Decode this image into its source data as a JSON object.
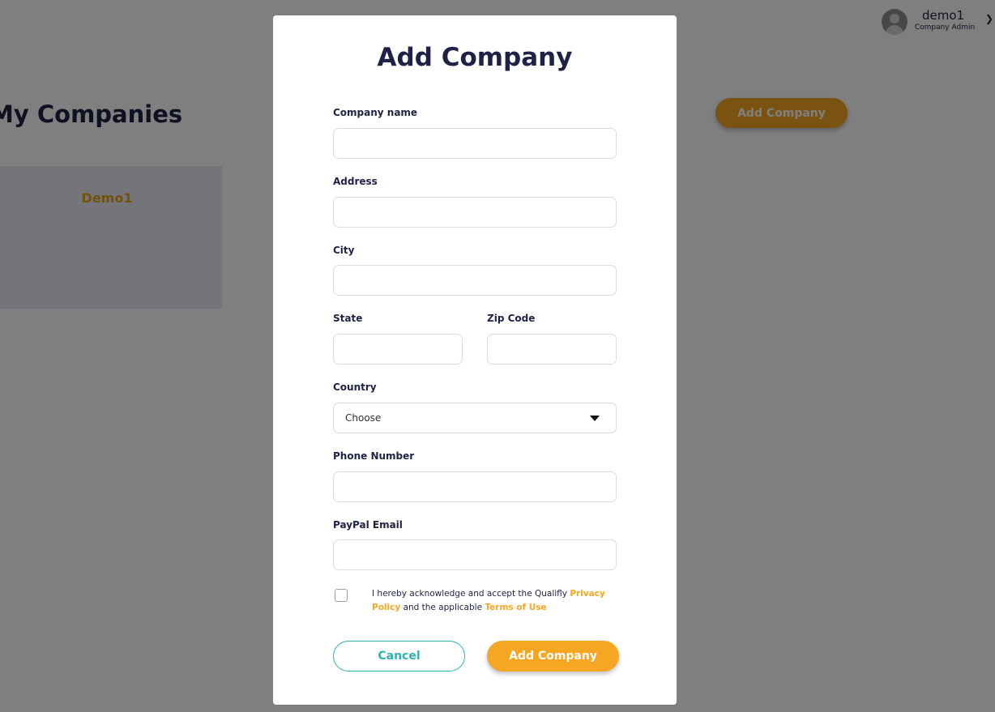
{
  "header": {
    "user_name": "demo1",
    "user_role": "Company Admin",
    "chevron_icon": "chevron-down-icon",
    "avatar_icon": "user-avatar-icon"
  },
  "background": {
    "page_title": "My Companies",
    "add_button_label": "Add Company",
    "companies": [
      {
        "name": "Demo1"
      }
    ]
  },
  "modal": {
    "title": "Add Company",
    "fields": {
      "company_name": {
        "label": "Company name",
        "value": ""
      },
      "address": {
        "label": "Address",
        "value": ""
      },
      "city": {
        "label": "City",
        "value": ""
      },
      "state": {
        "label": "State",
        "value": ""
      },
      "zip_code": {
        "label": "Zip Code",
        "value": ""
      },
      "country": {
        "label": "Country",
        "selected": "Choose"
      },
      "phone_number": {
        "label": "Phone Number",
        "value": ""
      },
      "paypal_email": {
        "label": "PayPal Email",
        "value": ""
      }
    },
    "consent": {
      "checked": false,
      "text_before": "I hereby acknowledge and accept the Qualifly ",
      "privacy_link": "Privacy Policy",
      "text_middle": " and the applicable ",
      "terms_link": "Terms of Use"
    },
    "cancel_label": "Cancel",
    "submit_label": "Add Company"
  },
  "colors": {
    "accent": "#f5a623",
    "teal": "#2bb3b1",
    "navy": "#1f2246"
  }
}
